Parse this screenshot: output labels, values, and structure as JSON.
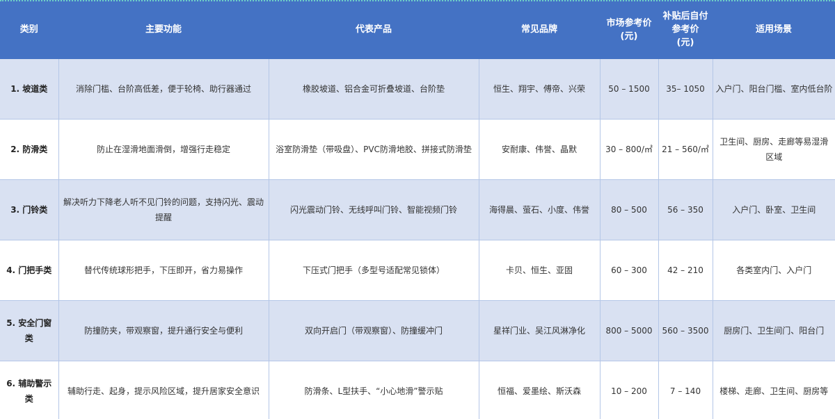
{
  "headers": {
    "category": "类别",
    "function": "主要功能",
    "products": "代表产品",
    "brands": "常见品牌",
    "market_price": "市场参考价\n(元)",
    "subsidy_price": "补贴后自付\n参考价\n(元)",
    "scenes": "适用场景"
  },
  "rows": [
    {
      "category": "1. 坡道类",
      "function": "消除门槛、台阶高低差，便于轮椅、助行器通过",
      "products": "橡胶坡道、铝合金可折叠坡道、台阶垫",
      "brands": "恒生、翔宇、傅帝、兴荣",
      "market_price": "50 – 1500",
      "subsidy_price": "35– 1050",
      "scenes": "入户门、阳台门槛、室内低台阶"
    },
    {
      "category": "2. 防滑类",
      "function": "防止在湿滑地面滑倒，增强行走稳定",
      "products": "浴室防滑垫（带吸盘）、PVC防滑地胶、拼接式防滑垫",
      "brands": "安耐康、伟誉、晶默",
      "market_price": "30 – 800/㎡",
      "subsidy_price": "21 – 560/㎡",
      "scenes": "卫生间、厨房、走廊等易湿滑区域"
    },
    {
      "category": "3. 门铃类",
      "function": "解决听力下降老人听不见门铃的问题，支持闪光、震动提醒",
      "products": "闪光震动门铃、无线呼叫门铃、智能视频门铃",
      "brands": "海得晨、萤石、小度、伟誉",
      "market_price": "80 – 500",
      "subsidy_price": "56 – 350",
      "scenes": "入户门、卧室、卫生间"
    },
    {
      "category": "4. 门把手类",
      "function": "替代传统球形把手，下压即开，省力易操作",
      "products": "下压式门把手（多型号适配常见锁体）",
      "brands": "卡贝、恒生、亚固",
      "market_price": "60 – 300",
      "subsidy_price": "42 – 210",
      "scenes": "各类室内门、入户门"
    },
    {
      "category": "5. 安全门窗类",
      "function": "防撞防夹，带观察窗，提升通行安全与便利",
      "products": "双向开启门（带观察窗）、防撞缓冲门",
      "brands": "星祥门业、吴江风淋净化",
      "market_price": "800 – 5000",
      "subsidy_price": "560 – 3500",
      "scenes": "厨房门、卫生间门、阳台门"
    },
    {
      "category": "6. 辅助警示类",
      "function": "辅助行走、起身，提示风险区域，提升居家安全意识",
      "products": "防滑条、L型扶手、“小心地滑”警示贴",
      "brands": "恒福、爱墨绘、斯沃森",
      "market_price": "10 – 200",
      "subsidy_price": "7 – 140",
      "scenes": "楼梯、走廊、卫生间、厨房等"
    }
  ]
}
